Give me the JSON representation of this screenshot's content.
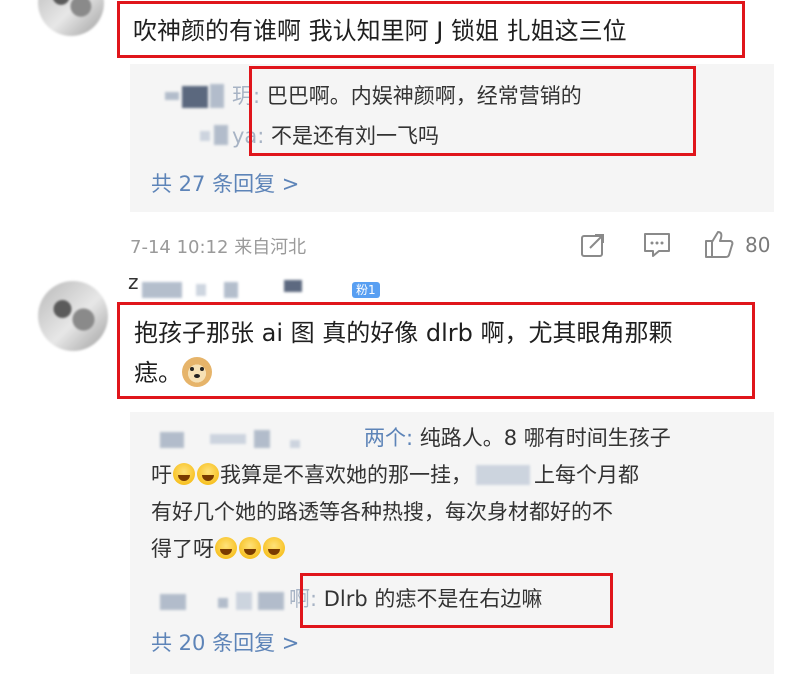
{
  "comment1": {
    "text": "吹神颜的有谁啊 我认知里阿 J 锁姐 扎姐这三位",
    "replies": [
      {
        "name_suffix": "玥:",
        "text": " 巴巴啊。内娱神颜啊，经常营销的"
      },
      {
        "name_suffix": "ya:",
        "text": " 不是还有刘一飞吗"
      }
    ],
    "more": "共 27 条回复 >",
    "meta": {
      "date": "7-14 10:12",
      "location": "来自河北",
      "like_count": "80"
    }
  },
  "comment2": {
    "author_prefix": "z",
    "badge": "粉1",
    "text_line1": "抱孩子那张 ai 图 真的好像 dlrb 啊，尤其眼角那颗",
    "text_line2": "痣。",
    "replies": {
      "r1": {
        "name": "两个:",
        "line1": " 纯路人。8 哪有时间生孩子",
        "line2_start": "吁",
        "line2_end": "我算是不喜欢她的那一挂，",
        "line2_tail": "上每个月都",
        "line3": "有好几个她的路透等各种热搜，每次身材都好的不",
        "line4": "得了呀"
      },
      "r2": {
        "name_suffix": "啊:",
        "text": " Dlrb 的痣不是在右边嘛"
      }
    },
    "more": "共 20 条回复 >"
  },
  "colors": {
    "highlight": "#e0151b",
    "link": "#5d84b8",
    "reply_bg": "#f5f5f5"
  },
  "icons": {
    "share": "share-icon",
    "comment": "comment-icon",
    "like": "thumbs-up-icon"
  }
}
